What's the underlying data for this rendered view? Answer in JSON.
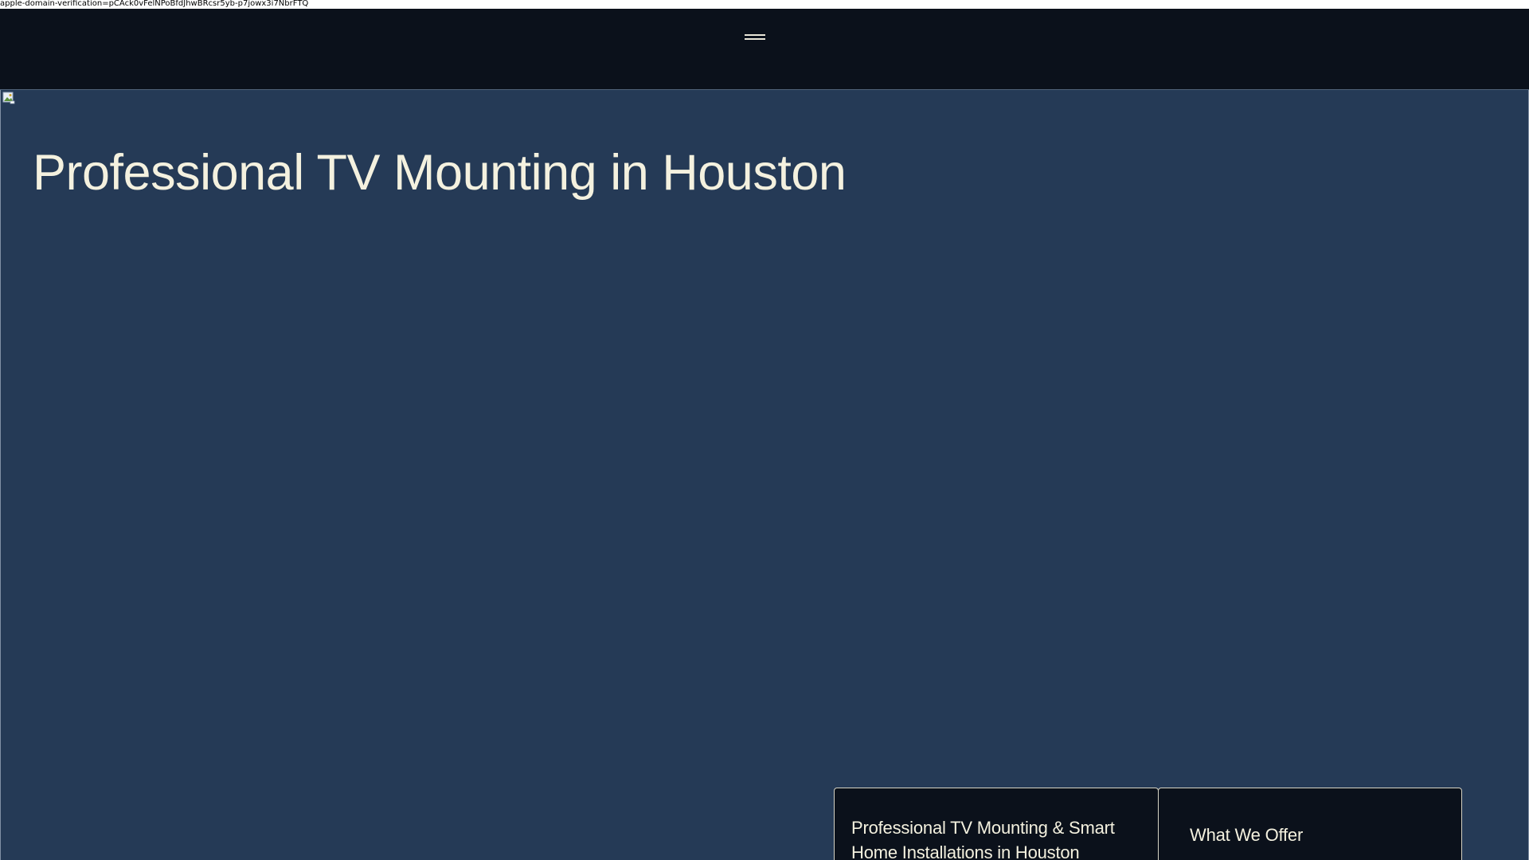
{
  "meta_bar": {
    "verification_text": "apple-domain-verification=pCAck0vFelNPoBfdJhwBRcsr5yb-p7jowx3i7NbrFTQ"
  },
  "header": {
    "menu_icon": "hamburger-menu-icon"
  },
  "hero": {
    "image_icon": "broken-image-icon",
    "title": "Professional TV Mounting in Houston"
  },
  "cards": {
    "left_title": "Professional TV Mounting & Smart Home Installations in Houston",
    "right_title": "What We Offer"
  },
  "colors": {
    "header_bg": "#0b111b",
    "hero_bg": "#253a56",
    "text_light": "#f4f1df",
    "card_bg": "#0b111b"
  }
}
